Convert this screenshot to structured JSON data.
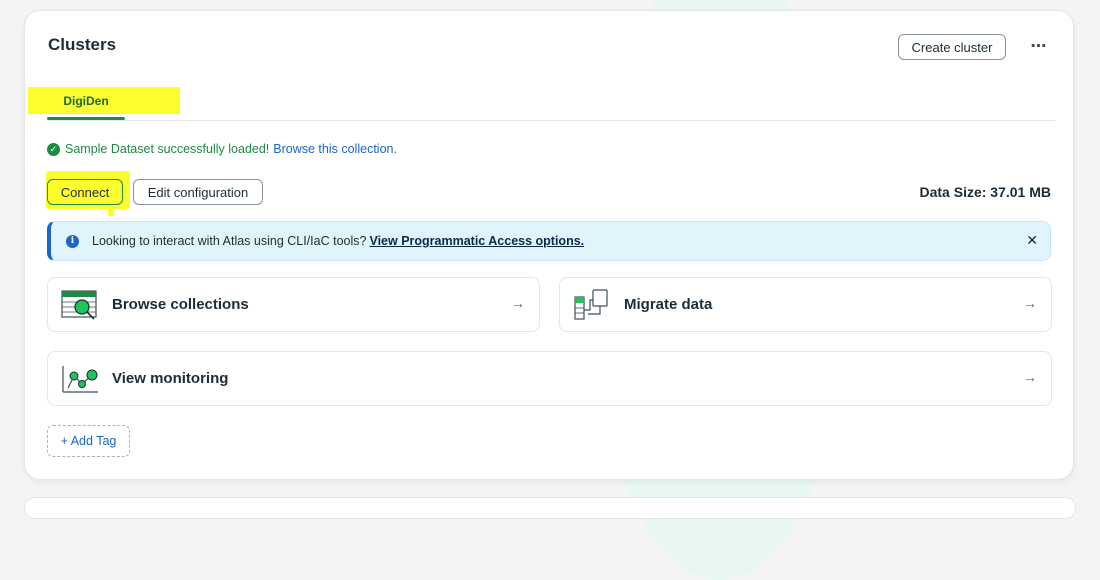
{
  "section": {
    "title": "Clusters",
    "create_button": "Create cluster",
    "more_icon": "ellipsis-icon"
  },
  "tab": {
    "label": "DigiDen"
  },
  "status": {
    "message": "Sample Dataset successfully loaded!",
    "link": "Browse this collection."
  },
  "actions": {
    "connect": "Connect",
    "edit": "Edit configuration",
    "data_size": "Data Size: 37.01 MB"
  },
  "banner": {
    "text": "Looking to interact with Atlas using CLI/IaC tools?",
    "link": "View Programmatic Access options.",
    "close_icon": "close-icon"
  },
  "cards": [
    {
      "label": "Browse collections",
      "icon": "browse-collections-icon"
    },
    {
      "label": "Migrate data",
      "icon": "migrate-data-icon"
    },
    {
      "label": "View monitoring",
      "icon": "monitoring-icon"
    }
  ],
  "add_tag": "+ Add Tag",
  "colors": {
    "accent_green": "#1f8a45",
    "link_blue": "#1a65c8",
    "banner_bg": "#e1f4fc",
    "highlight_yellow": "#fdfd2e"
  }
}
